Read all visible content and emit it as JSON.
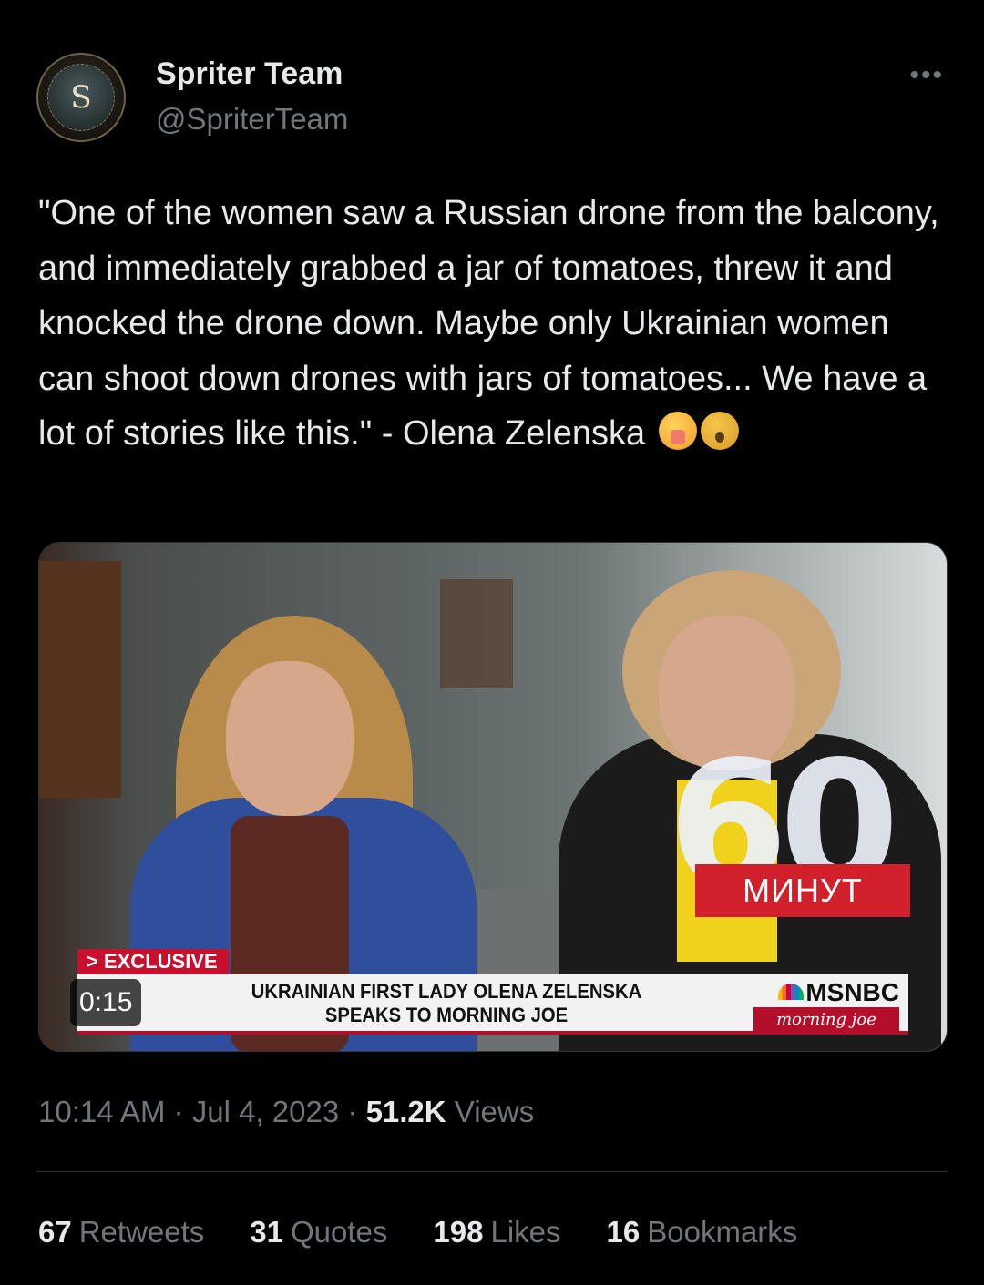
{
  "author": {
    "name": "Spriter Team",
    "handle": "@SpriterTeam",
    "avatar_letter": "S"
  },
  "more_label": "•••",
  "tweet": {
    "text": "\"One of the women saw a Russian drone from the balcony, and immediately grabbed a jar of tomatoes, threw it and knocked the drone down. Maybe only Ukrainian women can shoot down drones with jars of tomatoes... We have a lot of stories like this.\" - Olena Zelenska",
    "emojis": [
      "face-with-hand-over-mouth",
      "shaking-face"
    ]
  },
  "video": {
    "duration": "0:15",
    "logo_number": "60",
    "logo_word": "МИНУТ",
    "banner_tag": "> EXCLUSIVE",
    "headline_line1": "UKRAINIAN FIRST LADY OLENA ZELENSKA",
    "headline_line2": "SPEAKS TO MORNING JOE",
    "network": "MSNBC",
    "show": "morning joe"
  },
  "meta": {
    "time": "10:14 AM",
    "date": "Jul 4, 2023",
    "views_count": "51.2K",
    "views_label": "Views"
  },
  "stats": [
    {
      "count": "67",
      "label": "Retweets"
    },
    {
      "count": "31",
      "label": "Quotes"
    },
    {
      "count": "198",
      "label": "Likes"
    },
    {
      "count": "16",
      "label": "Bookmarks"
    }
  ],
  "colors": {
    "background": "#000000",
    "text_primary": "#e7e9ea",
    "text_secondary": "#71767b",
    "divider": "#2f3336",
    "msnbc_red": "#b40f2a"
  }
}
